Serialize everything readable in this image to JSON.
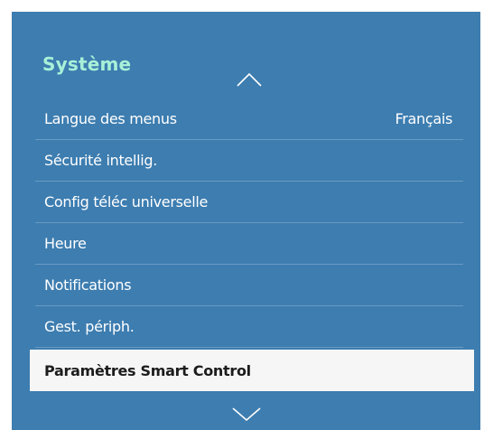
{
  "menu_title": "Système",
  "icons": {
    "scroll_up": "chevron-up-icon",
    "scroll_down": "chevron-down-icon"
  },
  "colors": {
    "panel_bg": "#3d7db0",
    "title": "#a8f0d8",
    "selected_bg": "#f6f6f6",
    "divider": "#6a9bc3"
  },
  "items": [
    {
      "label": "Langue des menus",
      "value": "Français"
    },
    {
      "label": "Sécurité intellig."
    },
    {
      "label": "Config téléc universelle"
    },
    {
      "label": "Heure"
    },
    {
      "label": "Notifications"
    },
    {
      "label": "Gest. périph."
    },
    {
      "label": "Paramètres Smart Control",
      "selected": true
    }
  ]
}
